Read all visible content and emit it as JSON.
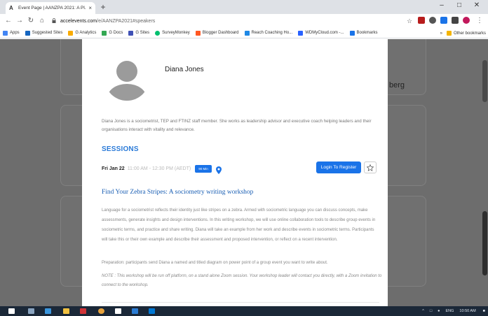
{
  "browser": {
    "tab": {
      "title": "Event Page | AANZPA 2021: A Pl...",
      "favicon": "A",
      "close": "×"
    },
    "new_tab": "+",
    "window_controls": {
      "minimize": "–",
      "maximize": "□",
      "close": "✕"
    },
    "nav": {
      "back": "←",
      "forward": "→",
      "reload": "↻",
      "home": "⌂"
    },
    "url": {
      "host": "accelevents.com",
      "path": "/e/AANZPA2021#speakers"
    },
    "lock_icon": "lock-icon",
    "star": "☆",
    "menu": "⋮"
  },
  "bookmarks": {
    "items": [
      {
        "label": "Apps",
        "color": "#4285f4"
      },
      {
        "label": "Suggested Sites",
        "color": "#1565c0"
      },
      {
        "label": "G Analytics",
        "color": "#f9ab00"
      },
      {
        "label": "G Docs",
        "color": "#4285f4"
      },
      {
        "label": "G Sites",
        "color": "#3f51b5"
      },
      {
        "label": "SurveyMonkey",
        "color": "#00bf6f"
      },
      {
        "label": "Blogger Dashboard",
        "color": "#ff5722"
      },
      {
        "label": "Reach Coaching Ho...",
        "color": "#1e88e5"
      },
      {
        "label": "WDMyCloud.com -...",
        "color": "#2962ff"
      },
      {
        "label": "Bookmarks",
        "color": "#1a73e8"
      }
    ],
    "overflow": "»",
    "other": "Other bookmarks"
  },
  "background": {
    "partial_text": "berg"
  },
  "speaker": {
    "name": "Diana Jones",
    "bio": "Diana Jones is a sociometrist, TEP and FTINZ staff member. She works as leadership advisor and executive coach helping leaders and their organisations interact with vitality and relevance."
  },
  "sessions": {
    "heading": "SESSIONS",
    "items": [
      {
        "date": "Fri Jan 22",
        "time": "11:00 AM - 12:30 PM (AEDT)",
        "duration": "90 Min",
        "login_label": "Login To Register",
        "title": "Find Your Zebra Stripes: A sociometry writing workshop",
        "description": "Language for a sociometrist reflects their identity just like stripes on a zebra. Armed with sociometric language you can discuss concepts, make assessments, generate insights and design interventions. In this writing workshop, we will use online collaboration tools to describe group events in sociometric terms, and practice and share writing. Diana will take an example from her work and describe events in sociometric terms. Participants will take this or their own example and describe their assessment and proposed intervention, or reflect on a recent intervention.",
        "preparation": "Preparation: participants send Diana a named and titled diagram on power point of a group event you want to write about.",
        "note": "NOTE : This workshop will be run off platform, on a stand alone Zoom session. Your workshop leader will contact you directly, with a Zoom invitation to connect to the workshop."
      }
    ]
  },
  "colors": {
    "accent": "#1a73e8",
    "heading": "#2a7ad8",
    "overlay": "#6d6d6d",
    "taskbar": "#1b2838"
  },
  "taskbar": {
    "lang": "ENG",
    "time": "10:50 AM"
  }
}
